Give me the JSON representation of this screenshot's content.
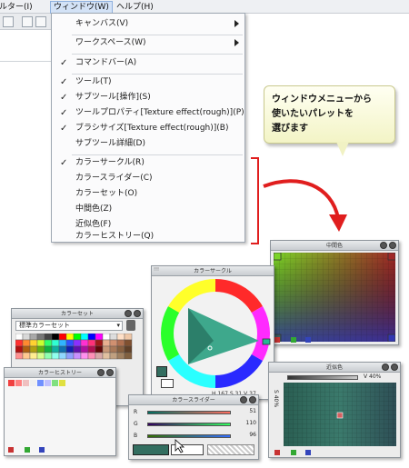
{
  "menubar": {
    "items": [
      {
        "label": "ルター(I)"
      },
      {
        "label": "ウィンドウ(W)"
      },
      {
        "label": "ヘルプ(H)"
      }
    ]
  },
  "dropdown": {
    "items": [
      {
        "label": "キャンバス(V)",
        "checked": false,
        "submenu": true
      },
      {
        "label": "ワークスペース(W)",
        "checked": false,
        "submenu": true
      },
      {
        "label": "コマンドバー(A)",
        "checked": true,
        "submenu": false
      },
      {
        "label": "ツール(T)",
        "checked": true,
        "submenu": false
      },
      {
        "label": "サブツール[操作](S)",
        "checked": true,
        "submenu": false
      },
      {
        "label": "ツールプロパティ[Texture effect(rough)](P)",
        "checked": true,
        "submenu": false
      },
      {
        "label": "ブラシサイズ[Texture effect(rough)](B)",
        "checked": true,
        "submenu": false
      },
      {
        "label": "サブツール詳細(D)",
        "checked": false,
        "submenu": false
      },
      {
        "label": "カラーサークル(R)",
        "checked": true,
        "submenu": false
      },
      {
        "label": "カラースライダー(C)",
        "checked": false,
        "submenu": false
      },
      {
        "label": "カラーセット(O)",
        "checked": false,
        "submenu": false
      },
      {
        "label": "中間色(Z)",
        "checked": false,
        "submenu": false
      },
      {
        "label": "近似色(F)",
        "checked": false,
        "submenu": false
      },
      {
        "label": "カラーヒストリー(Q)",
        "checked": false,
        "submenu": false
      }
    ]
  },
  "callout": {
    "line1": "ウィンドウメニューから",
    "line2": "使いたいパレットを",
    "line3": "選びます"
  },
  "palettes": {
    "color_set": {
      "title": "カラーセット",
      "selected_set": "標準カラーセット"
    },
    "color_history": {
      "title": "カラーヒストリー"
    },
    "color_circle": {
      "title": "カラーサークル",
      "h": "167",
      "s": "31",
      "v": "37"
    },
    "intermediate": {
      "title": "中間色"
    },
    "color_slider": {
      "title": "カラースライダー",
      "r_label": "R",
      "r_value": "51",
      "g_label": "G",
      "g_value": "110",
      "b_label": "B",
      "b_value": "96"
    },
    "approx": {
      "title": "近似色",
      "v_label": "V",
      "v_value": "40",
      "s_label": "S",
      "s_value": "40"
    }
  },
  "colors": {
    "accent_menu": "#d3e2f6",
    "bracket_red": "#e01e1e",
    "current_color": "#336e60"
  }
}
